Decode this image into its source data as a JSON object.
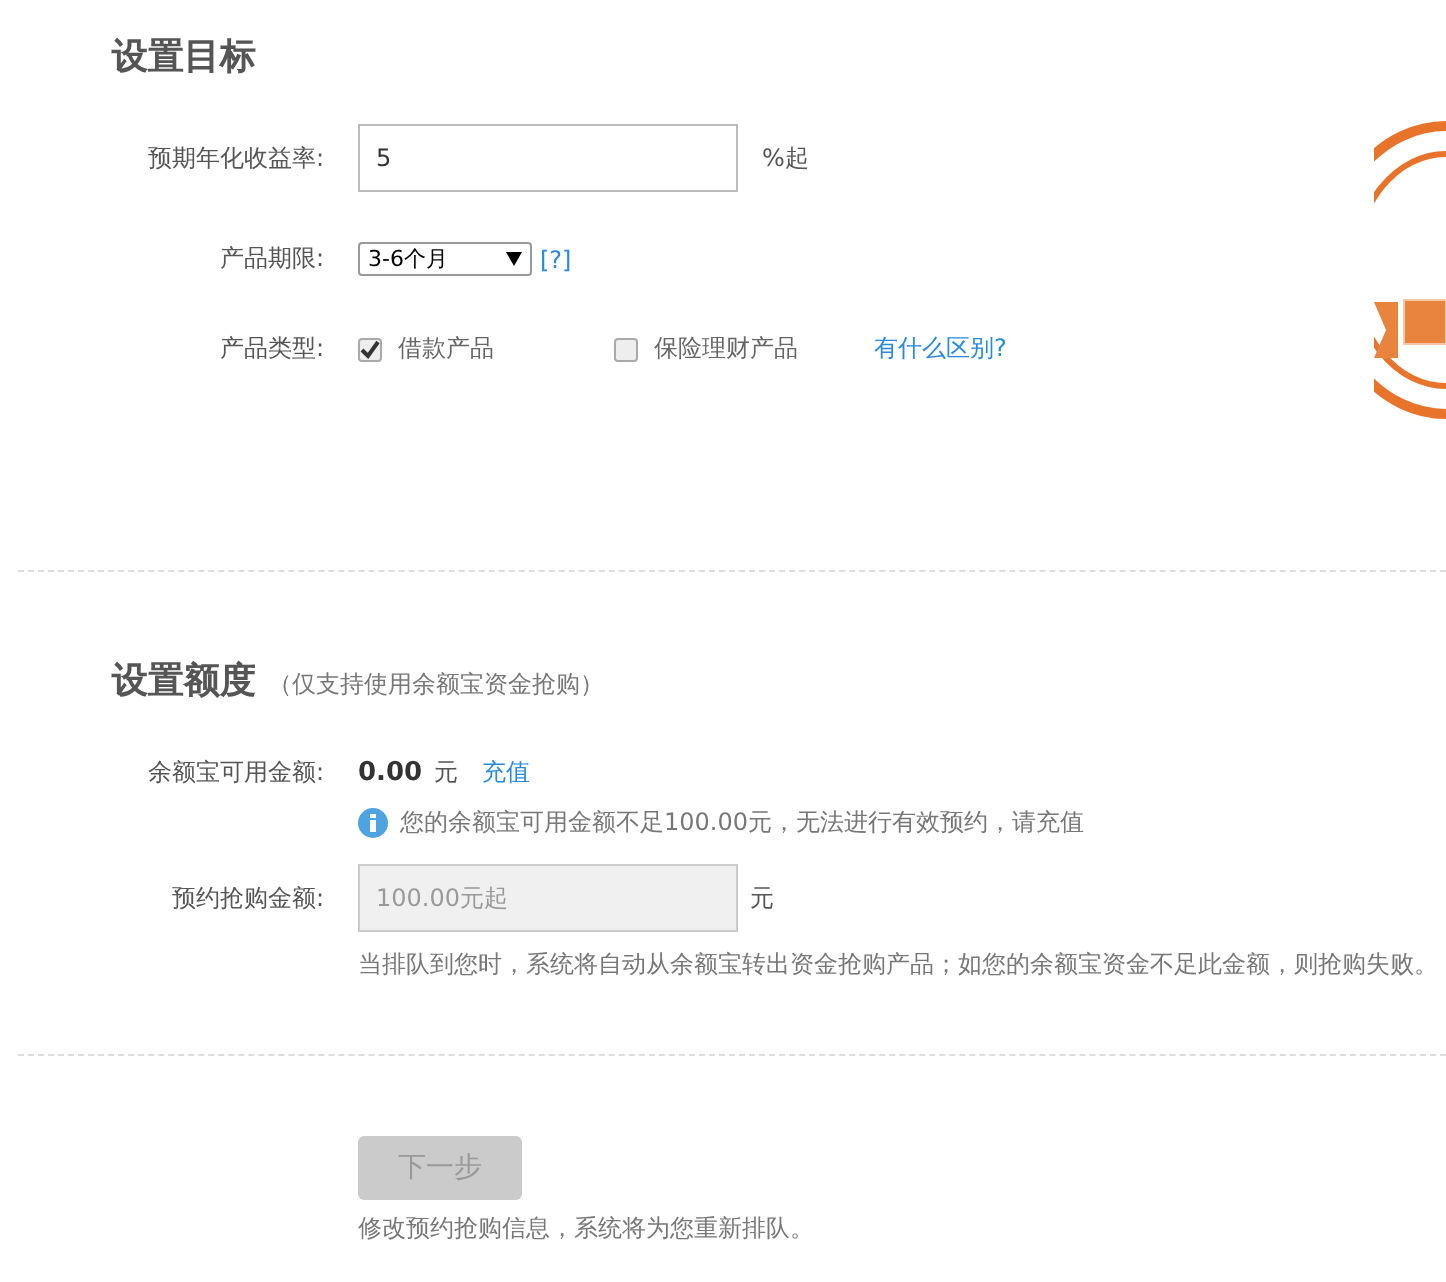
{
  "target": {
    "title": "设置目标",
    "yield": {
      "label": "预期年化收益率:",
      "value": "5",
      "suffix": "%起"
    },
    "term": {
      "label": "产品期限:",
      "value": "3-6个月",
      "help": "[?]"
    },
    "type": {
      "label": "产品类型:",
      "options": [
        {
          "label": "借款产品",
          "checked": true
        },
        {
          "label": "保险理财产品",
          "checked": false
        }
      ],
      "link": "有什么区别?"
    }
  },
  "amount": {
    "title": "设置额度",
    "subtitle": "（仅支持使用余额宝资金抢购）",
    "balance": {
      "label": "余额宝可用金额:",
      "value": "0.00",
      "unit": "元",
      "link": "充值",
      "notice": "您的余额宝可用金额不足100.00元，无法进行有效预约，请充值"
    },
    "reserve": {
      "label": "预约抢购金额:",
      "placeholder": "100.00元起",
      "disabled": true,
      "unit": "元",
      "hint": "当排队到您时，系统将自动从余额宝转出资金抢购产品；如您的余额宝资金不足此金额，则抢购失败。"
    }
  },
  "next": {
    "label": "下一步",
    "disabled": true,
    "note": "修改预约抢购信息，系统将为您重新排队。"
  }
}
